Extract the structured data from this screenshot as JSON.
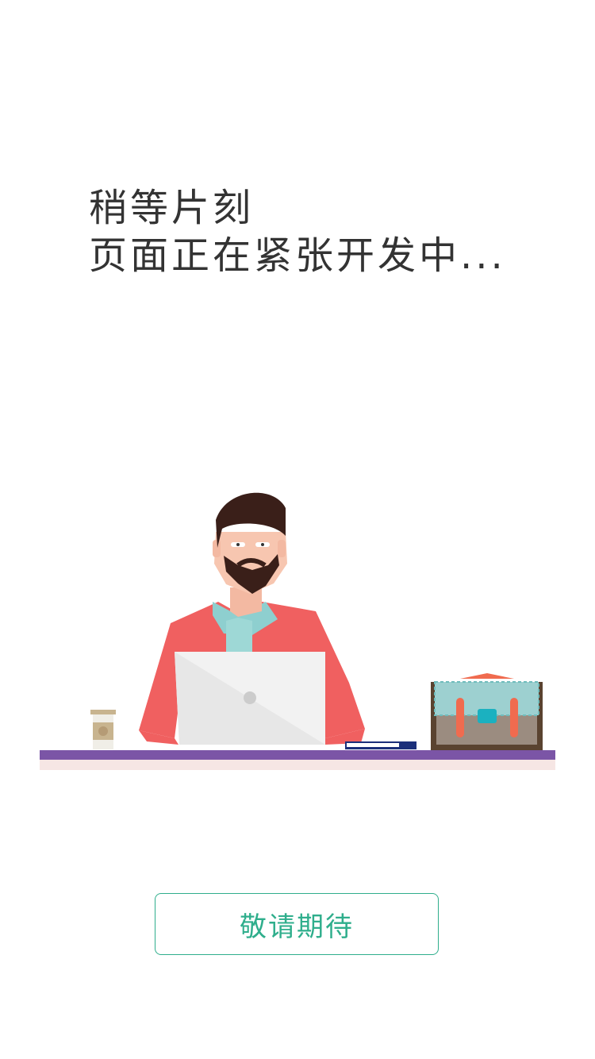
{
  "message": {
    "line1": "稍等片刻",
    "line2": "页面正在紧张开发中..."
  },
  "button": {
    "label": "敬请期待"
  },
  "illustration": {
    "subject": "developer-at-laptop",
    "icons": [
      "person-icon",
      "laptop-icon",
      "coffee-cup-icon",
      "book-icon",
      "briefcase-icon",
      "desk"
    ]
  },
  "colors": {
    "text": "#333333",
    "accent": "#2fae8c",
    "desk_top": "#7b55a6",
    "desk_base": "#f6e6e4",
    "shirt": "#f06060",
    "collar": "#8ecfcf",
    "hair": "#3a1f19",
    "skin": "#f7c6b0",
    "laptop": "#f2f2f2",
    "briefcase_body": "#5a4330",
    "briefcase_flap": "#9dd0d0"
  }
}
